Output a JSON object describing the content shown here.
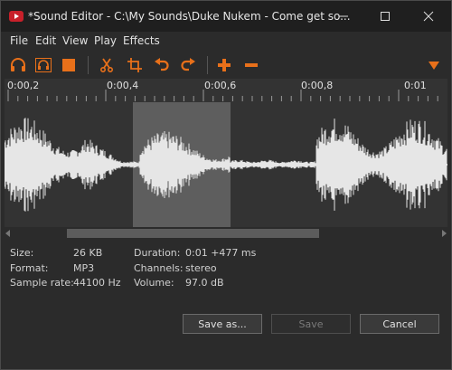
{
  "window": {
    "title": "*Sound Editor - C:\\My Sounds\\Duke Nukem - Come get so..."
  },
  "menu": [
    "File",
    "Edit",
    "View",
    "Play",
    "Effects"
  ],
  "toolbar": {
    "icons": [
      "headphones-icon",
      "headphones-selection-icon",
      "stop-icon",
      "cut-icon",
      "crop-icon",
      "undo-icon",
      "redo-icon",
      "plus-icon",
      "minus-icon",
      "dropdown-icon"
    ],
    "accent_color": "#e8701a"
  },
  "timeline": {
    "labels": [
      "0:00,2",
      "0:00,4",
      "0:00,6",
      "0:00,8",
      "0:01"
    ]
  },
  "waveform": {
    "selection": {
      "start_fraction": 0.29,
      "end_fraction": 0.51
    }
  },
  "scroll": {
    "position_fraction": 0.14,
    "thumb_fraction": 0.57
  },
  "info": {
    "size_label": "Size:",
    "size_value": "26 KB",
    "format_label": "Format:",
    "format_value": "MP3",
    "rate_label": "Sample rate:",
    "rate_value": "44100 Hz",
    "duration_label": "Duration:",
    "duration_value": "0:01 +477 ms",
    "channels_label": "Channels:",
    "channels_value": "stereo",
    "volume_label": "Volume:",
    "volume_value": "97.0 dB"
  },
  "buttons": {
    "save_as": "Save as...",
    "save": "Save",
    "cancel": "Cancel"
  }
}
